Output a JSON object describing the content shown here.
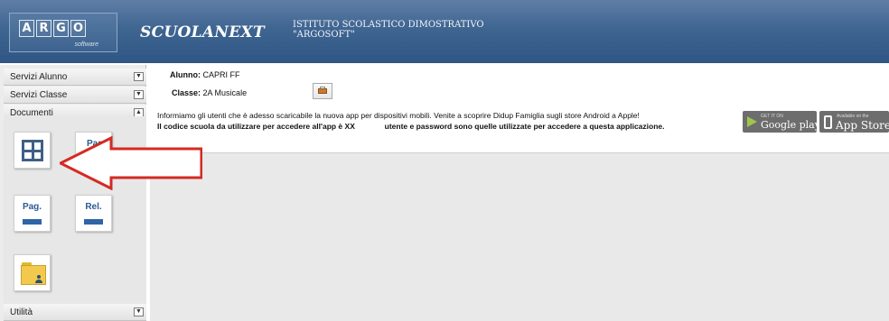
{
  "header": {
    "logo_letters": [
      "A",
      "R",
      "G",
      "O"
    ],
    "logo_sub": "software",
    "brand": "SCUOLANEXT",
    "institute_line1": "ISTITUTO SCOLASTICO DIMOSTRATIVO",
    "institute_line2": "\"ARGOSOFT\""
  },
  "sidebar": {
    "sections": [
      {
        "label": "Servizi Alunno",
        "toggle": "▼"
      },
      {
        "label": "Servizi Classe",
        "toggle": "▼"
      },
      {
        "label": "Documenti",
        "toggle": "▲"
      },
      {
        "label": "Utilità",
        "toggle": "▼"
      }
    ],
    "tiles": {
      "partial_label": "Pag",
      "pag_label": "Pag.",
      "rel_label": "Rel."
    }
  },
  "student": {
    "alunno_label": "Alunno:",
    "alunno_value": "CAPRI FF",
    "classe_label": "Classe:",
    "classe_value": "2A Musicale"
  },
  "info": {
    "line1": "Informiamo gli utenti che è adesso scaricabile la nuova app per dispositivi mobili. Venite a scoprire Didup Famiglia sugli store Android a Apple!",
    "line2a": "Il codice scuola da utilizzare per accedere all'app è XX",
    "line2b": "utente e password sono quelle utilizzate per accedere a questa applicazione."
  },
  "stores": {
    "google_small": "GET IT ON",
    "google_big": "Google play",
    "apple_small": "Available on the",
    "apple_big": "App Store"
  },
  "colors": {
    "header_blue": "#3f6591",
    "arrow_red": "#d42a22",
    "tile_blue": "#2f64a6",
    "folder_yellow": "#f2c94c"
  }
}
